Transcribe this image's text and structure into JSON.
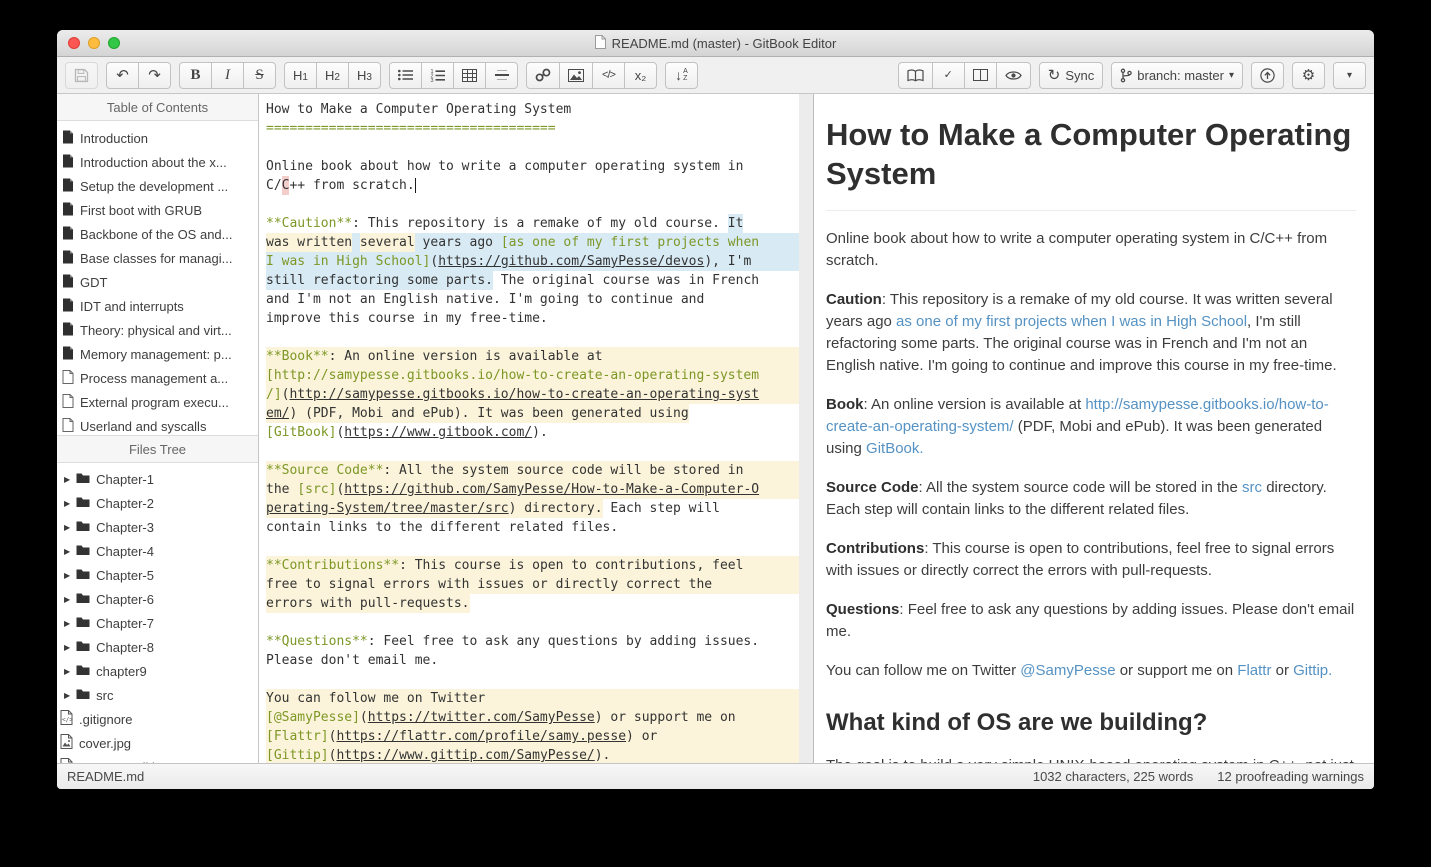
{
  "window": {
    "title": "README.md (master) - GitBook Editor"
  },
  "toolbar": {
    "left_groups": [
      [
        {
          "name": "save",
          "icon": "save",
          "disabled": true
        }
      ],
      [
        {
          "name": "undo",
          "icon": "undo"
        },
        {
          "name": "redo",
          "icon": "redo"
        }
      ],
      [
        {
          "name": "bold",
          "label": "B"
        },
        {
          "name": "italic",
          "label": "I"
        },
        {
          "name": "strikethrough",
          "label": "S"
        }
      ],
      [
        {
          "name": "heading-1",
          "label": "H1"
        },
        {
          "name": "heading-2",
          "label": "H2"
        },
        {
          "name": "heading-3",
          "label": "H3"
        }
      ],
      [
        {
          "name": "unordered-list",
          "icon": "ul"
        },
        {
          "name": "ordered-list",
          "icon": "ol"
        },
        {
          "name": "table",
          "icon": "table"
        },
        {
          "name": "horizontal-rule",
          "icon": "hr"
        }
      ],
      [
        {
          "name": "link",
          "icon": "link"
        },
        {
          "name": "image",
          "icon": "image"
        },
        {
          "name": "code",
          "icon": "code"
        },
        {
          "name": "subscript",
          "label": "x₂"
        }
      ],
      [
        {
          "name": "sort",
          "icon": "sort"
        }
      ]
    ],
    "right_groups": [
      [
        {
          "name": "book-preview",
          "icon": "book"
        },
        {
          "name": "spellcheck",
          "icon": "check"
        },
        {
          "name": "split-view",
          "icon": "columns"
        },
        {
          "name": "preview-toggle",
          "icon": "eye"
        }
      ],
      [
        {
          "name": "sync",
          "icon": "sync",
          "label": "Sync"
        }
      ],
      [
        {
          "name": "branch",
          "icon": "branch",
          "label": "branch: master",
          "caret": true
        }
      ],
      [
        {
          "name": "publish",
          "icon": "publish"
        }
      ],
      [
        {
          "name": "settings",
          "icon": "gear"
        }
      ],
      [
        {
          "name": "more",
          "icon": "caret"
        }
      ]
    ]
  },
  "sidebar": {
    "toc_header": "Table of Contents",
    "toc": [
      {
        "label": "Introduction",
        "icon": "page-filled"
      },
      {
        "label": "Introduction about the x...",
        "icon": "page-filled"
      },
      {
        "label": "Setup the development ...",
        "icon": "page-filled"
      },
      {
        "label": "First boot with GRUB",
        "icon": "page-filled"
      },
      {
        "label": "Backbone of the OS and...",
        "icon": "page-filled"
      },
      {
        "label": "Base classes for managi...",
        "icon": "page-filled"
      },
      {
        "label": "GDT",
        "icon": "page-filled"
      },
      {
        "label": "IDT and interrupts",
        "icon": "page-filled"
      },
      {
        "label": "Theory: physical and virt...",
        "icon": "page-filled"
      },
      {
        "label": "Memory management: p...",
        "icon": "page-filled"
      },
      {
        "label": "Process management a...",
        "icon": "page-outline"
      },
      {
        "label": "External program execu...",
        "icon": "page-outline"
      },
      {
        "label": "Userland and syscalls",
        "icon": "page-outline"
      }
    ],
    "files_header": "Files Tree",
    "files": [
      {
        "label": "Chapter-1",
        "type": "folder"
      },
      {
        "label": "Chapter-2",
        "type": "folder"
      },
      {
        "label": "Chapter-3",
        "type": "folder"
      },
      {
        "label": "Chapter-4",
        "type": "folder"
      },
      {
        "label": "Chapter-5",
        "type": "folder"
      },
      {
        "label": "Chapter-6",
        "type": "folder"
      },
      {
        "label": "Chapter-7",
        "type": "folder"
      },
      {
        "label": "Chapter-8",
        "type": "folder"
      },
      {
        "label": "chapter9",
        "type": "folder"
      },
      {
        "label": "src",
        "type": "folder"
      },
      {
        "label": ".gitignore",
        "type": "code"
      },
      {
        "label": "cover.jpg",
        "type": "image"
      },
      {
        "label": "cover_small.jpg",
        "type": "image"
      }
    ]
  },
  "editor": {
    "lines": [
      {
        "s": [
          [
            "How to Make a Computer Operating System",
            ""
          ]
        ]
      },
      {
        "s": [
          [
            "=====================================",
            "g"
          ]
        ]
      },
      {
        "s": []
      },
      {
        "s": [
          [
            "Online book about how to write a computer operating system in",
            ""
          ]
        ]
      },
      {
        "s": [
          [
            "C/",
            ""
          ],
          [
            "C",
            "pink"
          ],
          [
            "++ from scratch.",
            ""
          ],
          [
            "",
            "ibeam"
          ]
        ]
      },
      {
        "s": []
      },
      {
        "fill": "b",
        "s": [
          [
            "**Caution**",
            "g"
          ],
          [
            ": This repository is a remake of my old course. ",
            ""
          ],
          [
            "It",
            "b"
          ]
        ]
      },
      {
        "bg": "b",
        "s": [
          [
            "was written",
            "y"
          ],
          [
            " ",
            ""
          ],
          [
            "several",
            "y"
          ],
          [
            " years ago ",
            ""
          ],
          [
            "[as one of my first projects when",
            "g"
          ]
        ]
      },
      {
        "bg": "b",
        "s": [
          [
            "I was in High School]",
            "g"
          ],
          [
            "(",
            ""
          ],
          [
            "https://github.com/SamyPesse/devos",
            "u"
          ],
          [
            "), I'm",
            ""
          ]
        ]
      },
      {
        "s": [
          [
            "still refactoring some parts.",
            "b"
          ],
          [
            " The original course was in French",
            ""
          ]
        ]
      },
      {
        "s": [
          [
            "and I'm not an English native. I'm going to continue and",
            ""
          ]
        ]
      },
      {
        "s": [
          [
            "improve this course in my free-time.",
            ""
          ]
        ]
      },
      {
        "s": []
      },
      {
        "bg": "y",
        "s": [
          [
            "**Book**",
            "g"
          ],
          [
            ": An online version is available at",
            ""
          ]
        ]
      },
      {
        "bg": "y",
        "s": [
          [
            "[http://samypesse.gitbooks.io/how-to-create-an-operating-system",
            "g"
          ]
        ]
      },
      {
        "bg": "y",
        "s": [
          [
            "/]",
            "g"
          ],
          [
            "(",
            ""
          ],
          [
            "http://samypesse.gitbooks.io/how-to-create-an-operating-syst",
            "u"
          ]
        ]
      },
      {
        "s": [
          [
            "em/",
            "u y"
          ],
          [
            ") (PDF, Mobi and ePub). It was been generated using",
            "y"
          ]
        ]
      },
      {
        "s": [
          [
            "[GitBook]",
            "g"
          ],
          [
            "(",
            ""
          ],
          [
            "https://www.gitbook.com/",
            "u"
          ],
          [
            ").",
            ""
          ]
        ]
      },
      {
        "s": []
      },
      {
        "bg": "y",
        "s": [
          [
            "**Source Code**",
            "g"
          ],
          [
            ": All the system source code will be stored in",
            ""
          ]
        ]
      },
      {
        "bg": "y",
        "s": [
          [
            "the ",
            ""
          ],
          [
            "[src]",
            "g"
          ],
          [
            "(",
            ""
          ],
          [
            "https://github.com/SamyPesse/How-to-Make-a-Computer-O",
            "u"
          ]
        ]
      },
      {
        "s": [
          [
            "perating-System/tree/master/src",
            "u y"
          ],
          [
            ") directory.",
            "y"
          ],
          [
            " Each step will",
            ""
          ]
        ]
      },
      {
        "s": [
          [
            "contain links to the different related files.",
            ""
          ]
        ]
      },
      {
        "s": []
      },
      {
        "bg": "y",
        "s": [
          [
            "**Contributions**",
            "g"
          ],
          [
            ": This course is open to contributions, feel",
            ""
          ]
        ]
      },
      {
        "bg": "y",
        "s": [
          [
            "free to signal errors with issues or directly correct the",
            ""
          ]
        ]
      },
      {
        "s": [
          [
            "errors with pull-requests.",
            "y"
          ]
        ]
      },
      {
        "s": []
      },
      {
        "s": [
          [
            "**Questions**",
            "g"
          ],
          [
            ": Feel free to ask any questions by adding issues.",
            ""
          ]
        ]
      },
      {
        "s": [
          [
            "Please don't email me.",
            ""
          ]
        ]
      },
      {
        "s": []
      },
      {
        "bg": "y",
        "s": [
          [
            "You can follow me on Twitter",
            ""
          ]
        ]
      },
      {
        "bg": "y",
        "s": [
          [
            "[@SamyPesse]",
            "g"
          ],
          [
            "(",
            ""
          ],
          [
            "https://twitter.com/SamyPesse",
            "u"
          ],
          [
            ") or support me on",
            ""
          ]
        ]
      },
      {
        "bg": "y",
        "s": [
          [
            "[Flattr]",
            "g"
          ],
          [
            "(",
            ""
          ],
          [
            "https://flattr.com/profile/samy.pesse",
            "u"
          ],
          [
            ") or",
            ""
          ]
        ]
      },
      {
        "bg": "y",
        "s": [
          [
            "[Gittip]",
            "g"
          ],
          [
            "(",
            ""
          ],
          [
            "https://www.gittip.com/SamyPesse/",
            "u"
          ],
          [
            ").",
            ""
          ]
        ]
      }
    ]
  },
  "preview": {
    "blocks": [
      {
        "type": "h1",
        "s": [
          [
            "How to Make a Computer Operating System",
            ""
          ]
        ]
      },
      {
        "type": "p",
        "s": [
          [
            "Online book about how to write a computer operating system in C/C++ from scratch.",
            ""
          ]
        ]
      },
      {
        "type": "p",
        "s": [
          [
            "Caution",
            "b"
          ],
          [
            ": This repository is a remake of my old course. It was written several years ago ",
            ""
          ],
          [
            "as one of my first projects when I was in High School",
            "a"
          ],
          [
            ", I'm still refactoring some parts. The original course was in French and I'm not an English native. I'm going to continue and improve this course in my free-time.",
            ""
          ]
        ]
      },
      {
        "type": "p",
        "s": [
          [
            "Book",
            "b"
          ],
          [
            ": An online version is available at ",
            ""
          ],
          [
            "http://samypesse.gitbooks.io/how-to-create-an-operating-system/",
            "a"
          ],
          [
            " (PDF, Mobi and ePub). It was been generated using ",
            ""
          ],
          [
            "GitBook.",
            "a"
          ]
        ]
      },
      {
        "type": "p",
        "s": [
          [
            "Source Code",
            "b"
          ],
          [
            ": All the system source code will be stored in the ",
            ""
          ],
          [
            "src",
            "a"
          ],
          [
            " directory. Each step will contain links to the different related files.",
            ""
          ]
        ]
      },
      {
        "type": "p",
        "s": [
          [
            "Contributions",
            "b"
          ],
          [
            ": This course is open to contributions, feel free to signal errors with issues or directly correct the errors with pull-requests.",
            ""
          ]
        ]
      },
      {
        "type": "p",
        "s": [
          [
            "Questions",
            "b"
          ],
          [
            ": Feel free to ask any questions by adding issues. Please don't email me.",
            ""
          ]
        ]
      },
      {
        "type": "p",
        "s": [
          [
            "You can follow me on Twitter ",
            ""
          ],
          [
            "@SamyPesse",
            "a"
          ],
          [
            " or support me on ",
            ""
          ],
          [
            "Flattr",
            "a"
          ],
          [
            " or ",
            ""
          ],
          [
            "Gittip.",
            "a"
          ]
        ]
      },
      {
        "type": "h2",
        "s": [
          [
            "What kind of OS are we building?",
            ""
          ]
        ]
      },
      {
        "type": "p",
        "s": [
          [
            "The goal is to build a very simple UNIX-based operating system in C++, not just a \"proof-of-concept\". The OS should be able to boot, start a userland shell, and be extensible.",
            ""
          ]
        ]
      }
    ]
  },
  "statusbar": {
    "file": "README.md",
    "chars_words": "1032 characters, 225 words",
    "warnings": "12 proofreading warnings"
  },
  "colors": {
    "markdown_accent": "#7d9726",
    "highlight_cream": "#fbf4da",
    "highlight_blue": "#d8eaf4",
    "spell_error_pink": "#f3cdca",
    "preview_link_blue": "#5592c3"
  }
}
